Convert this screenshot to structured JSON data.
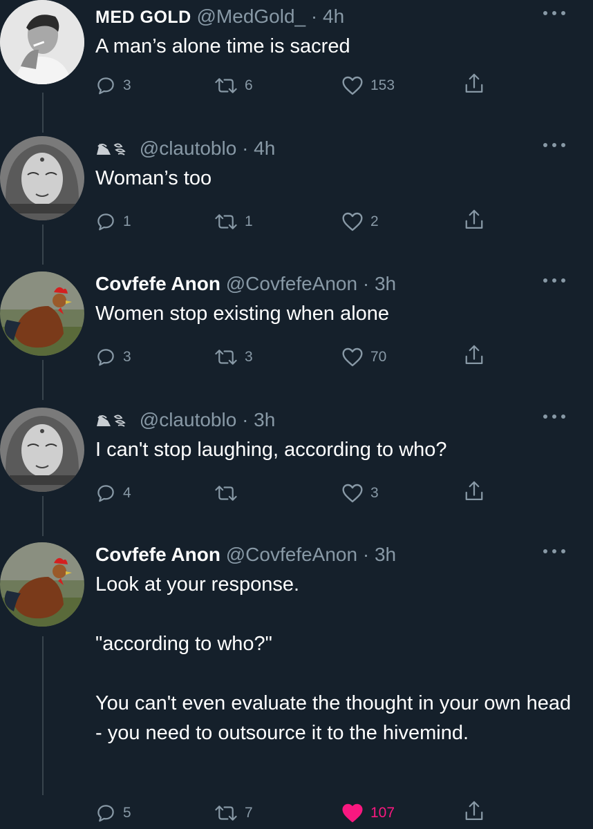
{
  "tweets": [
    {
      "name": "MED GOLD",
      "handle": "@MedGold_",
      "time": "· 4h",
      "text": "A man’s alone time is sacred",
      "replies": "3",
      "retweets": "6",
      "likes": "153",
      "liked": false,
      "avatar": "man-smoking-avatar"
    },
    {
      "name": "",
      "handle": "@clautoblo",
      "time": "· 4h",
      "text": "Woman’s too",
      "replies": "1",
      "retweets": "1",
      "likes": "2",
      "liked": false,
      "avatar": "woman-illustration-avatar"
    },
    {
      "name": "Covfefe Anon",
      "handle": "@CovfefeAnon",
      "time": "· 3h",
      "text": "Women stop existing when alone",
      "replies": "3",
      "retweets": "3",
      "likes": "70",
      "liked": false,
      "avatar": "rooster-avatar"
    },
    {
      "name": "",
      "handle": "@clautoblo",
      "time": "· 3h",
      "text": "I can't stop laughing, according to who?",
      "replies": "4",
      "retweets": "",
      "likes": "3",
      "liked": false,
      "avatar": "woman-illustration-avatar"
    },
    {
      "name": "Covfefe Anon",
      "handle": "@CovfefeAnon",
      "time": "· 3h",
      "text": "Look at your response.\n\n\"according to who?\"\n\nYou can't even evaluate the thought in your own head - you need to outsource it to the hivemind.",
      "replies": "5",
      "retweets": "7",
      "likes": "107",
      "liked": true,
      "avatar": "rooster-avatar"
    }
  ],
  "icons": {
    "reply": "reply-icon",
    "retweet": "retweet-icon",
    "like": "heart-icon",
    "share": "share-icon",
    "more": "more-icon"
  },
  "colors": {
    "background": "#15202b",
    "muted": "#8899a6",
    "like_active": "#f91880"
  }
}
